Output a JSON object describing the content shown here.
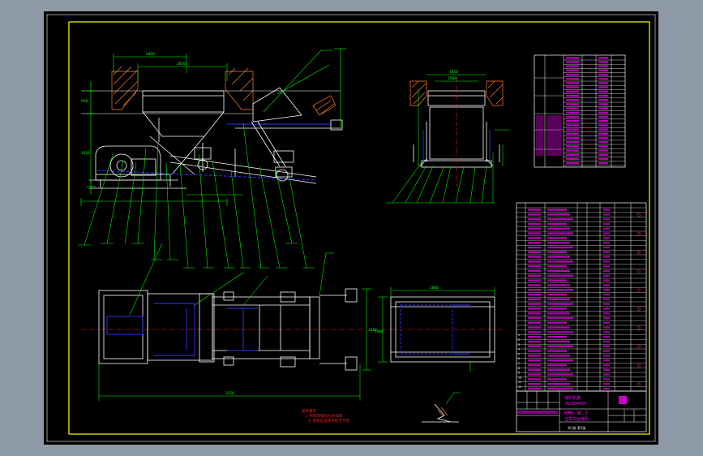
{
  "drawing": {
    "colors": {
      "viewport_bg": "#8e99a6",
      "sheet_bg": "#000000",
      "frame": "#ffff00",
      "structure": "#ffffff",
      "dimension": "#00ff00",
      "hidden_line": "#3333ff",
      "centerline": "#ff2020",
      "hatch": "#ff7f27",
      "table_text": "#ff00ff",
      "leader": "#00ff00"
    },
    "top_dims": [
      "2050",
      "2850"
    ],
    "side_dims": [
      "650",
      "1520"
    ],
    "plan_dims": [
      "3250",
      "1680"
    ],
    "right_dims": [
      "2800",
      "1800"
    ],
    "section_dims": [
      "2500",
      "1850"
    ]
  },
  "title_block": {
    "project": "煤矿机械",
    "drawing_number": "JB/Z04000",
    "model": "KMW-3K.3",
    "name": "往复式给煤机",
    "sheet": "共1张 第1张"
  },
  "bom": {
    "rows": [
      "12",
      "11",
      "10",
      "9",
      "8",
      "7",
      "6",
      "5",
      "4",
      "3",
      "2",
      "1"
    ]
  },
  "notes": [
    "技术要求",
    "1. 所有焊缝均为连续焊",
    "2. 装配后运转平稳无卡阻"
  ]
}
